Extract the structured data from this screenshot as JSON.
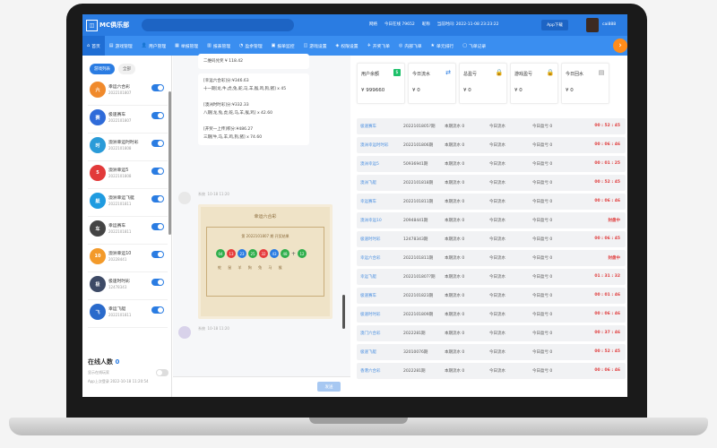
{
  "header": {
    "logo_text": "MC俱乐部",
    "info_items": [
      "网络",
      "今日在线 79652",
      "昵称",
      "当前时间: 2022-11-08 23:23:22"
    ],
    "app_download": "App下载",
    "username": "cai888"
  },
  "nav": {
    "items": [
      {
        "icon": "⌂",
        "label": "首页"
      },
      {
        "icon": "▤",
        "label": "游戏管理"
      },
      {
        "icon": "👤",
        "label": "用户管理"
      },
      {
        "icon": "▦",
        "label": "举报管理"
      },
      {
        "icon": "▥",
        "label": "报表管理"
      },
      {
        "icon": "◔",
        "label": "盈余管理"
      },
      {
        "icon": "▣",
        "label": "报单监控"
      },
      {
        "icon": "◫",
        "label": "游戏设置"
      },
      {
        "icon": "◈",
        "label": "权限设置"
      },
      {
        "icon": "✈",
        "label": "开奖飞单"
      },
      {
        "icon": "◎",
        "label": "内部飞单"
      },
      {
        "icon": "★",
        "label": "单元排行"
      },
      {
        "icon": "▢",
        "label": "飞单记录"
      }
    ],
    "more": "›"
  },
  "left_panel": {
    "tabs": [
      "游戏列表",
      "全部"
    ],
    "games": [
      {
        "name": "幸运六合彩",
        "issue": "2022101807",
        "icon": "六",
        "color": "#f08a2c"
      },
      {
        "name": "极速赛车",
        "issue": "2022101807",
        "icon": "赛",
        "color": "#2f6bd9"
      },
      {
        "name": "澳洲幸运时时彩",
        "issue": "2022101808",
        "icon": "时",
        "color": "#2a9bd8"
      },
      {
        "name": "澳洲幸运5",
        "issue": "2022101808",
        "icon": "5",
        "color": "#e23a3a"
      },
      {
        "name": "澳洲幸运飞艇",
        "issue": "2022101811",
        "icon": "艇",
        "color": "#1f9be0"
      },
      {
        "name": "幸运赛车",
        "issue": "2022101811",
        "icon": "车",
        "color": "#444444"
      },
      {
        "name": "澳洲幸运10",
        "issue": "20228441",
        "icon": "10",
        "color": "#f39a2a"
      },
      {
        "name": "极速时时彩",
        "issue": "12478343",
        "icon": "极",
        "color": "#3d4a66"
      },
      {
        "name": "幸运飞艇",
        "issue": "2022101811",
        "icon": "飞",
        "color": "#2a6acb"
      }
    ],
    "online_label": "在线人数",
    "online_count": "0",
    "online_sub": "显示在线玩家",
    "online_sub2": "App上次登录 2022-10-18 11:20:54"
  },
  "chat": {
    "bubble1_lines": [
      "二维码兑奖 ¥ 118.42"
    ],
    "bubble2_lines": [
      "[幸运六合彩]分:¥346.63",
      "十一期[龙,牛,虎,兔,蛇,马,羊,猴,鸡,狗,猪] x 45",
      "",
      "[澳洲时时彩]分:¥332.33",
      "八期[龙,兔,虎,蛇,马,羊,猴,鸡] x 42.60",
      "",
      "[开奖一上传]积分:¥486.27",
      "三期[牛,马,羊,鸡,狗,猪] x 74.60"
    ],
    "sender_name": "系统",
    "sender_time": "10-18 11:20",
    "card_title": "幸运六合彩",
    "card_issue": "第 2022101807 期 开奖结果",
    "balls": [
      {
        "n": "04",
        "c": "#2fae4c"
      },
      {
        "n": "13",
        "c": "#e63c3c"
      },
      {
        "n": "23",
        "c": "#2a7ce2"
      },
      {
        "n": "25",
        "c": "#2fae4c"
      },
      {
        "n": "32",
        "c": "#e63c3c"
      },
      {
        "n": "43",
        "c": "#2a7ce2"
      },
      {
        "n": "48",
        "c": "#2fae4c"
      },
      {
        "n": "12",
        "c": "#2fae4c"
      }
    ],
    "plus": "+",
    "zodiac": "蛇 鼠 羊 狗 兔 马 猴",
    "sender2_name": "系统",
    "sender2_time": "10-18 11:20",
    "send_label": "发送"
  },
  "stats": [
    {
      "label": "用户余额",
      "value": "¥ 999660",
      "icon": "$",
      "icon_style": "green"
    },
    {
      "label": "今日流水",
      "value": "¥ 0",
      "icon": "⇄",
      "icon_style": "blue"
    },
    {
      "label": "总盈亏",
      "value": "¥ 0",
      "icon": "🔒",
      "icon_style": "gray"
    },
    {
      "label": "游戏盈亏",
      "value": "¥ 0",
      "icon": "🔒",
      "icon_style": "gray"
    },
    {
      "label": "今日回水",
      "value": "¥ 0",
      "icon": "▤",
      "icon_style": "gray"
    }
  ],
  "rows": [
    {
      "game": "极速赛车",
      "issue": "2022101805?期",
      "f1": "本期流水 0",
      "f2": "今日流水",
      "f3": "今日盈亏 0",
      "time": "00 : 52 : 45"
    },
    {
      "game": "澳洲幸运时时彩",
      "issue": "2022101806期",
      "f1": "本期流水 0",
      "f2": "今日流水",
      "f3": "今日盈亏 0",
      "time": "00 : 06 : 46"
    },
    {
      "game": "澳洲幸运5",
      "issue": "50936941期",
      "f1": "本期流水 0",
      "f2": "今日流水",
      "f3": "今日盈亏 0",
      "time": "00 : 01 : 25"
    },
    {
      "game": "澳洲飞艇",
      "issue": "2022101818期",
      "f1": "本期流水 0",
      "f2": "今日流水",
      "f3": "今日盈亏 0",
      "time": "00 : 52 : 45"
    },
    {
      "game": "幸运赛车",
      "issue": "2022101811期",
      "f1": "本期流水 0",
      "f2": "今日流水",
      "f3": "今日盈亏 0",
      "time": "00 : 06 : 46"
    },
    {
      "game": "澳洲幸运10",
      "issue": "20948441期",
      "f1": "本期流水 0",
      "f2": "今日流水",
      "f3": "今日盈亏 0",
      "time": "封盘中"
    },
    {
      "game": "极速时时彩",
      "issue": "12478343期",
      "f1": "本期流水 0",
      "f2": "今日流水",
      "f3": "今日盈亏 0",
      "time": "00 : 06 : 45"
    },
    {
      "game": "幸运六合彩",
      "issue": "2022101811期",
      "f1": "本期流水 0",
      "f2": "今日流水",
      "f3": "今日盈亏 0",
      "time": "封盘中"
    },
    {
      "game": "幸运飞艇",
      "issue": "2022101807?期",
      "f1": "本期流水 0",
      "f2": "今日流水",
      "f3": "今日盈亏 0",
      "time": "01 : 31 : 32"
    },
    {
      "game": "极速赛车",
      "issue": "2022101823期",
      "f1": "本期流水 0",
      "f2": "今日流水",
      "f3": "今日盈亏 0",
      "time": "00 : 01 : 46"
    },
    {
      "game": "极速时时彩",
      "issue": "2022101809期",
      "f1": "本期流水 0",
      "f2": "今日流水",
      "f3": "今日盈亏 0",
      "time": "00 : 06 : 46"
    },
    {
      "game": "澳门六合彩",
      "issue": "2022281期",
      "f1": "本期流水 0",
      "f2": "今日流水",
      "f3": "今日盈亏 0",
      "time": "00 : 37 : 46"
    },
    {
      "game": "极速飞艇",
      "issue": "32010076期",
      "f1": "本期流水 0",
      "f2": "今日流水",
      "f3": "今日盈亏 0",
      "time": "00 : 52 : 45"
    },
    {
      "game": "香港六合彩",
      "issue": "2022281期",
      "f1": "本期流水 0",
      "f2": "今日流水",
      "f3": "今日盈亏 0",
      "time": "00 : 06 : 46"
    }
  ]
}
